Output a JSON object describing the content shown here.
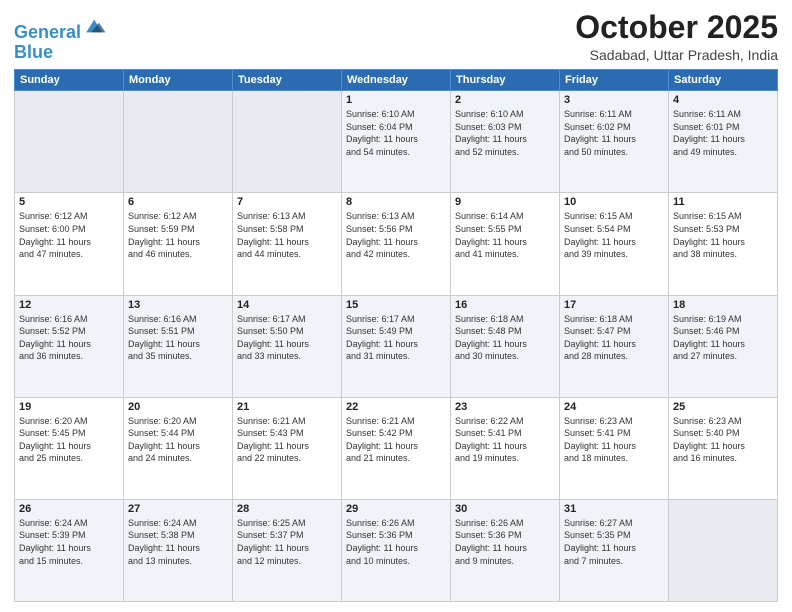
{
  "header": {
    "logo_line1": "General",
    "logo_line2": "Blue",
    "month": "October 2025",
    "location": "Sadabad, Uttar Pradesh, India"
  },
  "weekdays": [
    "Sunday",
    "Monday",
    "Tuesday",
    "Wednesday",
    "Thursday",
    "Friday",
    "Saturday"
  ],
  "weeks": [
    [
      {
        "day": "",
        "info": ""
      },
      {
        "day": "",
        "info": ""
      },
      {
        "day": "",
        "info": ""
      },
      {
        "day": "1",
        "info": "Sunrise: 6:10 AM\nSunset: 6:04 PM\nDaylight: 11 hours\nand 54 minutes."
      },
      {
        "day": "2",
        "info": "Sunrise: 6:10 AM\nSunset: 6:03 PM\nDaylight: 11 hours\nand 52 minutes."
      },
      {
        "day": "3",
        "info": "Sunrise: 6:11 AM\nSunset: 6:02 PM\nDaylight: 11 hours\nand 50 minutes."
      },
      {
        "day": "4",
        "info": "Sunrise: 6:11 AM\nSunset: 6:01 PM\nDaylight: 11 hours\nand 49 minutes."
      }
    ],
    [
      {
        "day": "5",
        "info": "Sunrise: 6:12 AM\nSunset: 6:00 PM\nDaylight: 11 hours\nand 47 minutes."
      },
      {
        "day": "6",
        "info": "Sunrise: 6:12 AM\nSunset: 5:59 PM\nDaylight: 11 hours\nand 46 minutes."
      },
      {
        "day": "7",
        "info": "Sunrise: 6:13 AM\nSunset: 5:58 PM\nDaylight: 11 hours\nand 44 minutes."
      },
      {
        "day": "8",
        "info": "Sunrise: 6:13 AM\nSunset: 5:56 PM\nDaylight: 11 hours\nand 42 minutes."
      },
      {
        "day": "9",
        "info": "Sunrise: 6:14 AM\nSunset: 5:55 PM\nDaylight: 11 hours\nand 41 minutes."
      },
      {
        "day": "10",
        "info": "Sunrise: 6:15 AM\nSunset: 5:54 PM\nDaylight: 11 hours\nand 39 minutes."
      },
      {
        "day": "11",
        "info": "Sunrise: 6:15 AM\nSunset: 5:53 PM\nDaylight: 11 hours\nand 38 minutes."
      }
    ],
    [
      {
        "day": "12",
        "info": "Sunrise: 6:16 AM\nSunset: 5:52 PM\nDaylight: 11 hours\nand 36 minutes."
      },
      {
        "day": "13",
        "info": "Sunrise: 6:16 AM\nSunset: 5:51 PM\nDaylight: 11 hours\nand 35 minutes."
      },
      {
        "day": "14",
        "info": "Sunrise: 6:17 AM\nSunset: 5:50 PM\nDaylight: 11 hours\nand 33 minutes."
      },
      {
        "day": "15",
        "info": "Sunrise: 6:17 AM\nSunset: 5:49 PM\nDaylight: 11 hours\nand 31 minutes."
      },
      {
        "day": "16",
        "info": "Sunrise: 6:18 AM\nSunset: 5:48 PM\nDaylight: 11 hours\nand 30 minutes."
      },
      {
        "day": "17",
        "info": "Sunrise: 6:18 AM\nSunset: 5:47 PM\nDaylight: 11 hours\nand 28 minutes."
      },
      {
        "day": "18",
        "info": "Sunrise: 6:19 AM\nSunset: 5:46 PM\nDaylight: 11 hours\nand 27 minutes."
      }
    ],
    [
      {
        "day": "19",
        "info": "Sunrise: 6:20 AM\nSunset: 5:45 PM\nDaylight: 11 hours\nand 25 minutes."
      },
      {
        "day": "20",
        "info": "Sunrise: 6:20 AM\nSunset: 5:44 PM\nDaylight: 11 hours\nand 24 minutes."
      },
      {
        "day": "21",
        "info": "Sunrise: 6:21 AM\nSunset: 5:43 PM\nDaylight: 11 hours\nand 22 minutes."
      },
      {
        "day": "22",
        "info": "Sunrise: 6:21 AM\nSunset: 5:42 PM\nDaylight: 11 hours\nand 21 minutes."
      },
      {
        "day": "23",
        "info": "Sunrise: 6:22 AM\nSunset: 5:41 PM\nDaylight: 11 hours\nand 19 minutes."
      },
      {
        "day": "24",
        "info": "Sunrise: 6:23 AM\nSunset: 5:41 PM\nDaylight: 11 hours\nand 18 minutes."
      },
      {
        "day": "25",
        "info": "Sunrise: 6:23 AM\nSunset: 5:40 PM\nDaylight: 11 hours\nand 16 minutes."
      }
    ],
    [
      {
        "day": "26",
        "info": "Sunrise: 6:24 AM\nSunset: 5:39 PM\nDaylight: 11 hours\nand 15 minutes."
      },
      {
        "day": "27",
        "info": "Sunrise: 6:24 AM\nSunset: 5:38 PM\nDaylight: 11 hours\nand 13 minutes."
      },
      {
        "day": "28",
        "info": "Sunrise: 6:25 AM\nSunset: 5:37 PM\nDaylight: 11 hours\nand 12 minutes."
      },
      {
        "day": "29",
        "info": "Sunrise: 6:26 AM\nSunset: 5:36 PM\nDaylight: 11 hours\nand 10 minutes."
      },
      {
        "day": "30",
        "info": "Sunrise: 6:26 AM\nSunset: 5:36 PM\nDaylight: 11 hours\nand 9 minutes."
      },
      {
        "day": "31",
        "info": "Sunrise: 6:27 AM\nSunset: 5:35 PM\nDaylight: 11 hours\nand 7 minutes."
      },
      {
        "day": "",
        "info": ""
      }
    ]
  ]
}
